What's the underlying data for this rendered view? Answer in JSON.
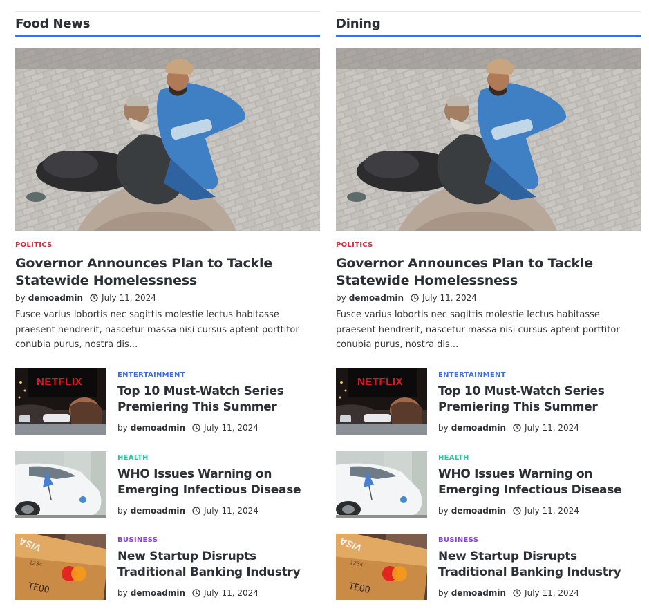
{
  "columns": [
    {
      "title": "Food News",
      "hero": {
        "category": "POLITICS",
        "category_color": "#d92b3a",
        "title": "Governor Announces Plan to Tackle Statewide Homelessness",
        "by": "by",
        "author": "demoadmin",
        "date": "July 11, 2024",
        "excerpt": "Fusce varius lobortis nec sagittis molestie lectus habitasse praesent hendrerit, nascetur massa nisi cursus aptent porttitor conubia purus, nostra dis..."
      },
      "items": [
        {
          "category": "ENTERTAINMENT",
          "category_color": "#3b6ee8",
          "title": "Top 10 Must-Watch Series Premiering This Summer",
          "by": "by",
          "author": "demoadmin",
          "date": "July 11, 2024",
          "thumb": "netflix-tv-photo"
        },
        {
          "category": "HEALTH",
          "category_color": "#2ec4a0",
          "title": "WHO Issues Warning on Emerging Infectious Disease",
          "by": "by",
          "author": "demoadmin",
          "date": "July 11, 2024",
          "thumb": "white-car-flag-photo"
        },
        {
          "category": "BUSINESS",
          "category_color": "#8b3fd9",
          "title": "New Startup Disrupts Traditional Banking Industry",
          "by": "by",
          "author": "demoadmin",
          "date": "July 11, 2024",
          "thumb": "credit-cards-photo"
        }
      ]
    },
    {
      "title": "Dining",
      "hero": {
        "category": "POLITICS",
        "category_color": "#d92b3a",
        "title": "Governor Announces Plan to Tackle Statewide Homelessness",
        "by": "by",
        "author": "demoadmin",
        "date": "July 11, 2024",
        "excerpt": "Fusce varius lobortis nec sagittis molestie lectus habitasse praesent hendrerit, nascetur massa nisi cursus aptent porttitor conubia purus, nostra dis..."
      },
      "items": [
        {
          "category": "ENTERTAINMENT",
          "category_color": "#3b6ee8",
          "title": "Top 10 Must-Watch Series Premiering This Summer",
          "by": "by",
          "author": "demoadmin",
          "date": "July 11, 2024",
          "thumb": "netflix-tv-photo"
        },
        {
          "category": "HEALTH",
          "category_color": "#2ec4a0",
          "title": "WHO Issues Warning on Emerging Infectious Disease",
          "by": "by",
          "author": "demoadmin",
          "date": "July 11, 2024",
          "thumb": "white-car-flag-photo"
        },
        {
          "category": "BUSINESS",
          "category_color": "#8b3fd9",
          "title": "New Startup Disrupts Traditional Banking Industry",
          "by": "by",
          "author": "demoadmin",
          "date": "July 11, 2024",
          "thumb": "credit-cards-photo"
        }
      ]
    }
  ],
  "accent_color": "#3b6ee8",
  "thumb_text": {
    "netflix": "NETFLIX",
    "card_brand": "VISA"
  }
}
